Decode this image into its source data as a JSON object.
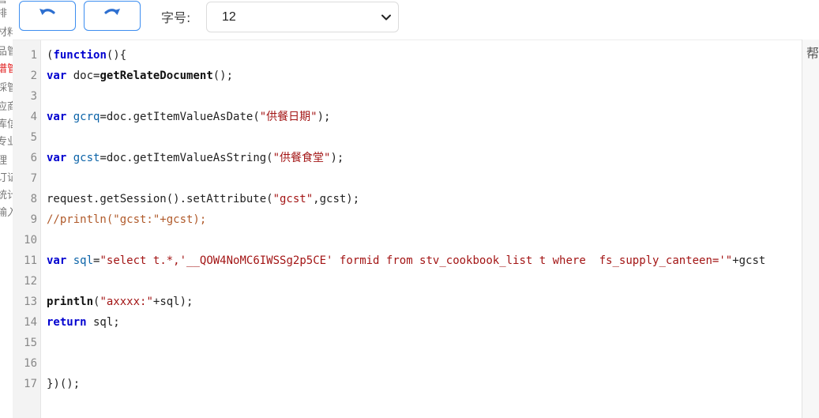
{
  "left_menu": {
    "items": [
      {
        "label": "管",
        "active": false
      },
      {
        "label": "排",
        "active": false
      },
      {
        "label": "材料",
        "active": false
      },
      {
        "label": "品管",
        "active": false
      },
      {
        "label": "谱管",
        "active": true
      },
      {
        "label": "採管",
        "active": false
      },
      {
        "label": "应商",
        "active": false
      },
      {
        "label": "库信",
        "active": false
      },
      {
        "label": "专业",
        "active": false
      },
      {
        "label": "理",
        "active": false
      },
      {
        "label": "订证",
        "active": false
      },
      {
        "label": "统计",
        "active": false
      },
      {
        "label": "输入",
        "active": false
      }
    ]
  },
  "toolbar": {
    "undo_icon": "undo-icon",
    "redo_icon": "redo-icon",
    "font_size_label": "字号:",
    "font_size_value": "12",
    "accent_color": "#3d8ef0"
  },
  "editor": {
    "line_numbers": [
      "1",
      "2",
      "3",
      "4",
      "5",
      "6",
      "7",
      "8",
      "9",
      "10",
      "11",
      "12",
      "13",
      "14",
      "15",
      "16",
      "17"
    ],
    "lines": [
      [
        {
          "t": "(",
          "c": ""
        },
        {
          "t": "function",
          "c": "kw"
        },
        {
          "t": "(){",
          "c": ""
        }
      ],
      [
        {
          "t": "var",
          "c": "kw"
        },
        {
          "t": " doc=",
          "c": ""
        },
        {
          "t": "getRelateDocument",
          "c": "fn"
        },
        {
          "t": "();",
          "c": ""
        }
      ],
      [],
      [
        {
          "t": "var",
          "c": "kw"
        },
        {
          "t": " ",
          "c": ""
        },
        {
          "t": "gcrq",
          "c": "var"
        },
        {
          "t": "=doc.getItemValueAsDate(",
          "c": ""
        },
        {
          "t": "\"供餐日期\"",
          "c": "str"
        },
        {
          "t": ");",
          "c": ""
        }
      ],
      [],
      [
        {
          "t": "var",
          "c": "kw"
        },
        {
          "t": " ",
          "c": ""
        },
        {
          "t": "gcst",
          "c": "var"
        },
        {
          "t": "=doc.getItemValueAsString(",
          "c": ""
        },
        {
          "t": "\"供餐食堂\"",
          "c": "str"
        },
        {
          "t": ");",
          "c": ""
        }
      ],
      [],
      [
        {
          "t": "request.getSession().setAttribute(",
          "c": ""
        },
        {
          "t": "\"gcst\"",
          "c": "str"
        },
        {
          "t": ",gcst);",
          "c": ""
        }
      ],
      [
        {
          "t": "//println(\"gcst:\"+gcst);",
          "c": "cmt"
        }
      ],
      [],
      [
        {
          "t": "var",
          "c": "kw"
        },
        {
          "t": " ",
          "c": ""
        },
        {
          "t": "sql",
          "c": "var"
        },
        {
          "t": "=",
          "c": ""
        },
        {
          "t": "\"select t.*,'__QOW4NoMC6IWSSg2p5CE' formid from stv_cookbook_list t where  fs_supply_canteen='\"",
          "c": "str"
        },
        {
          "t": "+gcst",
          "c": ""
        }
      ],
      [],
      [
        {
          "t": "println",
          "c": "fn"
        },
        {
          "t": "(",
          "c": ""
        },
        {
          "t": "\"axxxx:\"",
          "c": "str"
        },
        {
          "t": "+sql);",
          "c": ""
        }
      ],
      [
        {
          "t": "return",
          "c": "kw"
        },
        {
          "t": " sql;",
          "c": ""
        }
      ],
      [],
      [],
      [
        {
          "t": "})();",
          "c": ""
        }
      ]
    ]
  },
  "help_panel": {
    "label": "帮助"
  }
}
